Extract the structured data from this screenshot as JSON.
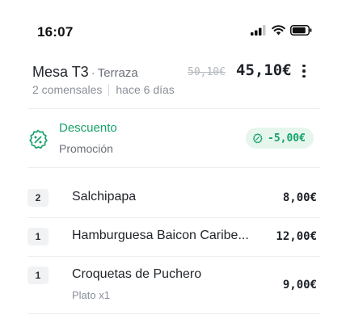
{
  "status_bar": {
    "time": "16:07",
    "icons": [
      "signal-icon",
      "wifi-icon",
      "battery-icon"
    ]
  },
  "order": {
    "table": "Mesa T3",
    "separator": "·",
    "location": "Terraza",
    "guests": "2 comensales",
    "age": "hace 6 días",
    "old_total": "50,10€",
    "total": "45,10€",
    "menu_icon": "more-vertical-icon"
  },
  "discount": {
    "icon": "discount-badge-icon",
    "title": "Descuento",
    "subtitle": "Promoción",
    "amount": "-5,00€"
  },
  "items": [
    {
      "qty": "2",
      "name": "Salchipapa",
      "note": "",
      "price": "8,00€"
    },
    {
      "qty": "1",
      "name": "Hamburguesa Baicon Caribe...",
      "note": "",
      "price": "12,00€"
    },
    {
      "qty": "1",
      "name": "Croquetas de Puchero",
      "note": "Plato x1",
      "price": "9,00€"
    }
  ],
  "colors": {
    "accent_green": "#16a36a",
    "badge_bg": "#e6f6ed",
    "text": "#1f2329",
    "muted": "#8a8f98"
  }
}
